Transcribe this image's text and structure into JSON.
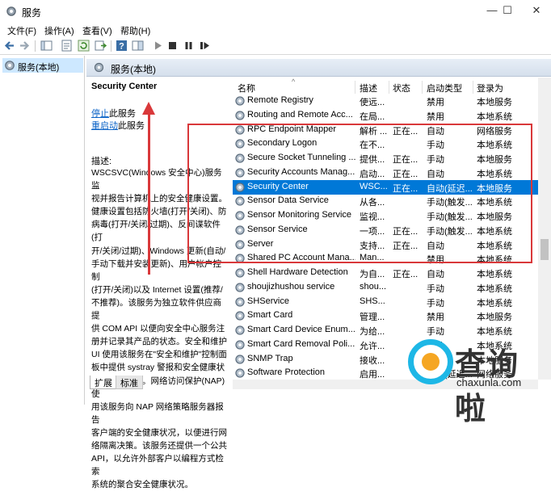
{
  "window": {
    "title": "服务",
    "minimize": "—",
    "maximize": "☐",
    "close": "✕"
  },
  "menu": [
    "文件(F)",
    "操作(A)",
    "查看(V)",
    "帮助(H)"
  ],
  "tree": {
    "item": "服务(本地)"
  },
  "pane": {
    "header": "服务(本地)"
  },
  "description": {
    "service_name": "Security Center",
    "stop_link": "停止",
    "stop_suffix": "此服务",
    "restart_link": "重启动",
    "restart_suffix": "此服务",
    "label": "描述:",
    "body": "WSCSVC(Windows 安全中心)服务监\n视并报告计算机上的安全健康设置。\n健康设置包括防火墙(打开/关闭)、防\n病毒(打开/关闭/过期)、反间谍软件(打\n开/关闭/过期)、Windows 更新(自动/\n手动下载并安装更新)、用户帐户控制\n(打开/关闭)以及 Internet 设置(推荐/\n不推荐)。该服务为独立软件供应商提\n供 COM API 以便向安全中心服务注\n册并记录其产品的状态。安全和维护\nUI 使用该服务在\"安全和维护\"控制面\n板中提供 systray 警报和安全健康状\n况的图形视图。网络访问保护(NAP)使\n用该服务向 NAP 网络策略服务器报告\n客户端的安全健康状况，以便进行网\n络隔离决策。该服务还提供一个公共\nAPI，以允许外部客户以编程方式检索\n系统的聚合安全健康状况。"
  },
  "bottom_tabs": [
    "扩展",
    "标准"
  ],
  "columns": {
    "name": "名称",
    "description": "描述",
    "status": "状态",
    "startup": "启动类型",
    "logon": "登录为"
  },
  "services": [
    {
      "name": "Remote Registry",
      "desc": "使远...",
      "status": "",
      "startup": "禁用",
      "logon": "本地服务"
    },
    {
      "name": "Routing and Remote Acc...",
      "desc": "在局...",
      "status": "",
      "startup": "禁用",
      "logon": "本地系统"
    },
    {
      "name": "RPC Endpoint Mapper",
      "desc": "解析 ...",
      "status": "正在...",
      "startup": "自动",
      "logon": "网络服务"
    },
    {
      "name": "Secondary Logon",
      "desc": "在不...",
      "status": "",
      "startup": "手动",
      "logon": "本地系统"
    },
    {
      "name": "Secure Socket Tunneling ...",
      "desc": "提供...",
      "status": "正在...",
      "startup": "手动",
      "logon": "本地服务"
    },
    {
      "name": "Security Accounts Manag...",
      "desc": "启动...",
      "status": "正在...",
      "startup": "自动",
      "logon": "本地系统"
    },
    {
      "name": "Security Center",
      "desc": "WSC...",
      "status": "正在...",
      "startup": "自动(延迟...",
      "logon": "本地服务",
      "selected": true
    },
    {
      "name": "Sensor Data Service",
      "desc": "从各...",
      "status": "",
      "startup": "手动(触发...",
      "logon": "本地系统"
    },
    {
      "name": "Sensor Monitoring Service",
      "desc": "监视...",
      "status": "",
      "startup": "手动(触发...",
      "logon": "本地服务"
    },
    {
      "name": "Sensor Service",
      "desc": "一项...",
      "status": "正在...",
      "startup": "手动(触发...",
      "logon": "本地系统"
    },
    {
      "name": "Server",
      "desc": "支持...",
      "status": "正在...",
      "startup": "自动",
      "logon": "本地系统"
    },
    {
      "name": "Shared PC Account Mana...",
      "desc": "Man...",
      "status": "",
      "startup": "禁用",
      "logon": "本地系统"
    },
    {
      "name": "Shell Hardware Detection",
      "desc": "为自...",
      "status": "正在...",
      "startup": "自动",
      "logon": "本地系统"
    },
    {
      "name": "shoujizhushou service",
      "desc": "shou...",
      "status": "",
      "startup": "手动",
      "logon": "本地系统"
    },
    {
      "name": "SHService",
      "desc": "SHS...",
      "status": "",
      "startup": "手动",
      "logon": "本地系统"
    },
    {
      "name": "Smart Card",
      "desc": "管理...",
      "status": "",
      "startup": "禁用",
      "logon": "本地服务"
    },
    {
      "name": "Smart Card Device Enum...",
      "desc": "为给...",
      "status": "",
      "startup": "手动",
      "logon": "本地系统"
    },
    {
      "name": "Smart Card Removal Poli...",
      "desc": "允许...",
      "status": "",
      "startup": "手动",
      "logon": "本地系统"
    },
    {
      "name": "SNMP Trap",
      "desc": "接收...",
      "status": "",
      "startup": "手动",
      "logon": "本地服务"
    },
    {
      "name": "Software Protection",
      "desc": "启用...",
      "status": "",
      "startup": "自动(延迟...",
      "logon": "网络服务"
    }
  ],
  "watermark": {
    "text": "查询啦",
    "url": "chaxunla.com"
  },
  "colors": {
    "selection": "#0078d7",
    "link": "#0b63c7",
    "annotation": "#d9383a",
    "watermark_ring": "#1db7e6"
  }
}
